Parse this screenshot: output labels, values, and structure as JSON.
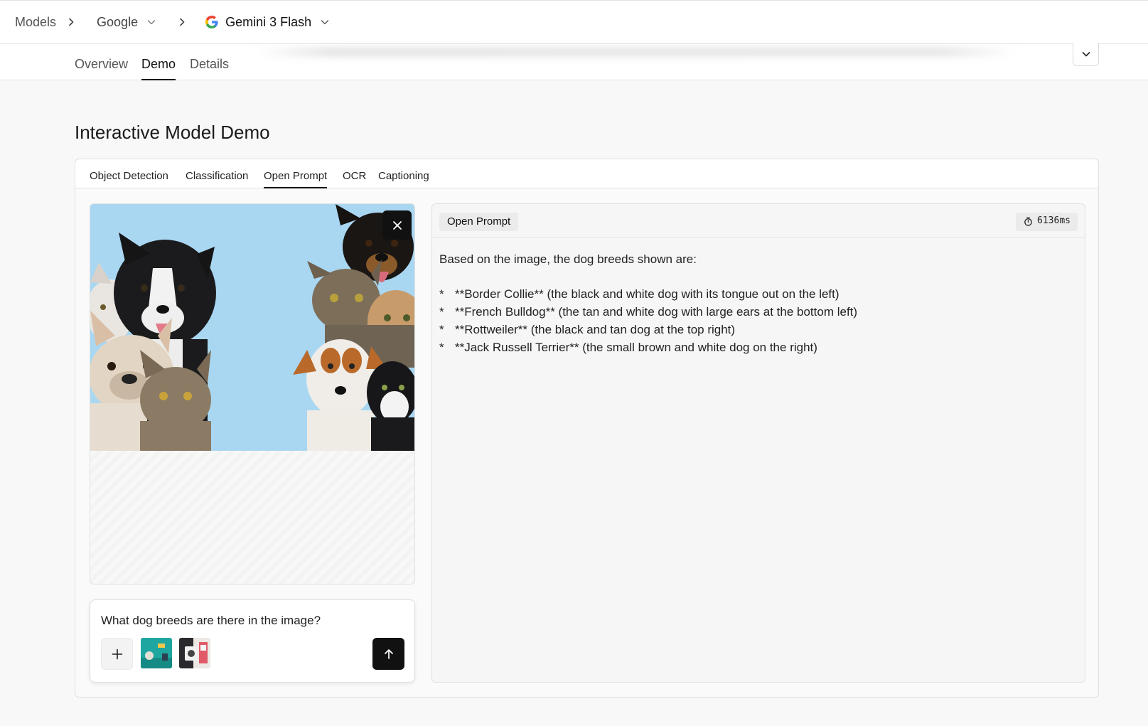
{
  "breadcrumb": {
    "root": "Models",
    "provider": "Google",
    "model": "Gemini 3 Flash"
  },
  "subnav": {
    "tabs": [
      {
        "label": "Overview",
        "active": false
      },
      {
        "label": "Demo",
        "active": true
      },
      {
        "label": "Details",
        "active": false
      }
    ]
  },
  "section": {
    "title": "Interactive Model Demo"
  },
  "demo_tabs": [
    {
      "label": "Object Detection",
      "active": false
    },
    {
      "label": "Classification",
      "active": false
    },
    {
      "label": "Open Prompt",
      "active": true
    },
    {
      "label": "OCR",
      "active": false
    },
    {
      "label": "Captioning",
      "active": false
    }
  ],
  "prompt": {
    "text": "What dog breeds are there in the image?"
  },
  "output": {
    "badge": "Open Prompt",
    "latency": "6136ms",
    "intro": "Based on the image, the dog breeds shown are:",
    "bullet": "*",
    "items": [
      "**Border Collie** (the black and white dog with its tongue out on the left)",
      "**French Bulldog** (the tan and white dog with large ears at the bottom left)",
      "**Rottweiler** (the black and tan dog at the top right)",
      "**Jack Russell Terrier** (the small brown and white dog on the right)"
    ]
  },
  "icons": {
    "breadcrumb_separator": "chevron-right-icon",
    "dropdown": "chevron-down-icon",
    "provider_logo": "google-logo-icon",
    "collapse": "chevron-down-icon",
    "remove_image": "close-icon",
    "add_attachment": "plus-icon",
    "send": "arrow-up-icon",
    "latency": "stopwatch-icon"
  },
  "colors": {
    "accent": "#111111",
    "photo_background": "#a9d7f2",
    "page_background": "#f8f8f8"
  }
}
